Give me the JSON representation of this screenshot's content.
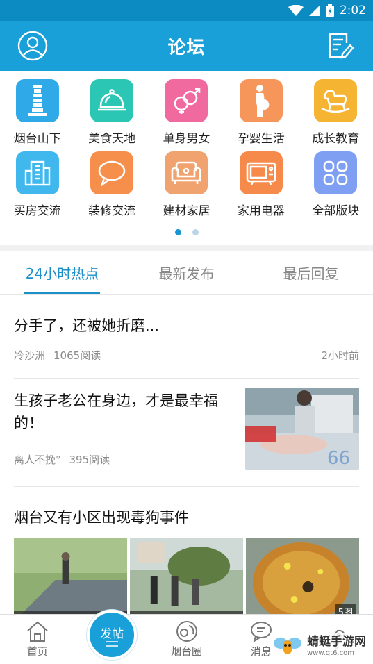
{
  "status": {
    "time": "2:02"
  },
  "appbar": {
    "title": "论坛"
  },
  "categories": [
    {
      "label": "烟台山下",
      "icon": "lighthouse-icon",
      "color": "#2fa9e8"
    },
    {
      "label": "美食天地",
      "icon": "food-cloche-icon",
      "color": "#2cc6b5"
    },
    {
      "label": "单身男女",
      "icon": "gender-icon",
      "color": "#f06aa0"
    },
    {
      "label": "孕婴生活",
      "icon": "pregnant-icon",
      "color": "#f7965b"
    },
    {
      "label": "成长教育",
      "icon": "rocking-horse-icon",
      "color": "#f5b431"
    },
    {
      "label": "买房交流",
      "icon": "building-icon",
      "color": "#40b8ee"
    },
    {
      "label": "装修交流",
      "icon": "speech-bubble-icon",
      "color": "#f78f4c"
    },
    {
      "label": "建材家居",
      "icon": "sofa-icon",
      "color": "#f0a36f"
    },
    {
      "label": "家用电器",
      "icon": "tv-icon",
      "color": "#f58a4b"
    },
    {
      "label": "全部版块",
      "icon": "grid-icon",
      "color": "#7f9ff2"
    }
  ],
  "tabs": [
    {
      "label": "24小时热点"
    },
    {
      "label": "最新发布"
    },
    {
      "label": "最后回复"
    }
  ],
  "posts": [
    {
      "title": "分手了，还被她折磨...",
      "author": "冷沙洲",
      "reads": "1065阅读",
      "time": "2小时前"
    },
    {
      "title": "生孩子老公在身边，才是最幸福的！",
      "author": "离人不挽°",
      "reads": "395阅读"
    },
    {
      "title": "烟台又有小区出现毒狗事件",
      "image_badge": "5图"
    }
  ],
  "bottom_nav": {
    "home": "首页",
    "post": "发帖",
    "circle": "烟台圈",
    "messages": "消息"
  },
  "watermark": {
    "main": "蜻蜓手游网",
    "sub": "www.qt6.com"
  }
}
